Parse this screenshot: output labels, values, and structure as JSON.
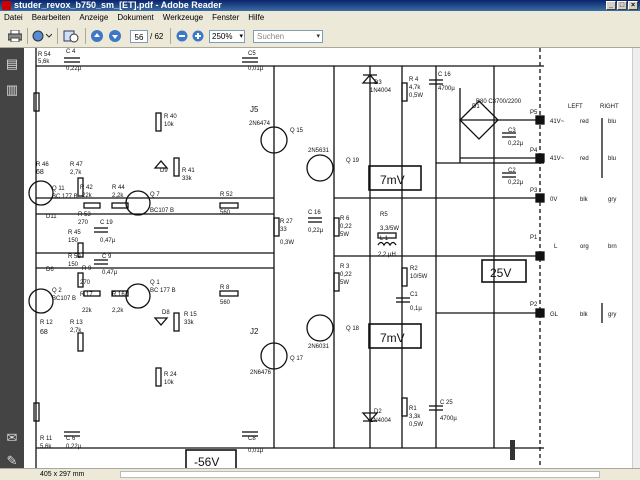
{
  "window": {
    "title": "studer_revox_b750_sm_[ET].pdf - Adobe Reader"
  },
  "menu": [
    "Datei",
    "Bearbeiten",
    "Anzeige",
    "Dokument",
    "Werkzeuge",
    "Fenster",
    "Hilfe"
  ],
  "toolbar": {
    "page_current": "56",
    "page_total": "/ 62",
    "zoom": "250%",
    "search_placeholder": "Suchen"
  },
  "status": {
    "page_size": "405 x 297 mm"
  },
  "schematic": {
    "labels": {
      "r54": "R 54",
      "r54v": "5,6k",
      "c4": "C 4",
      "c4v": "0,22µ",
      "c5": "C5",
      "c5v": "0,01µ",
      "r40": "R 40",
      "r40v": "10k",
      "j5": "J5",
      "q15": "Q 15",
      "q15t": "2N6474",
      "d9": "D9",
      "r41": "R 41",
      "r41v": "33k",
      "q19t": "2N5631",
      "q19": "Q 19",
      "r46": "R 46",
      "r46v": "68",
      "r47": "R 47",
      "r47v": "2,7k",
      "q11": "Q 11",
      "q11t": "BC 177 B",
      "r42": "R 42",
      "r42v": "22k",
      "r44": "R 44",
      "r44v": "2,2k",
      "q7": "Q 7",
      "q7t": "BC107 B",
      "r52": "R 52",
      "r52v": "560",
      "d11": "D11",
      "r53": "R 53",
      "r53v": "270",
      "c19": "C 19",
      "c19v": "0,47µ",
      "r45": "R 45",
      "r45v": "150",
      "r59": "R 59",
      "r59v": "150",
      "r9": "R 9",
      "r9v": "270",
      "c9": "C 9",
      "c9v": "0,47µ",
      "d6": "D6",
      "q2": "Q 2",
      "q2t": "BC107 B",
      "r17": "R 17",
      "r17v": "22k",
      "r16": "R 16",
      "r16v": "2,2k",
      "q1": "Q 1",
      "q1t": "BC 177 B",
      "r8": "R 8",
      "r8v": "560",
      "r12": "R 12",
      "r12v": "68",
      "r13": "R 13",
      "r13v": "2,7k",
      "d8": "D8",
      "r15": "R 15",
      "r15v": "33k",
      "j2": "J2",
      "q17": "Q 17",
      "q17t": "2N6476",
      "r24": "R 24",
      "r24v": "10k",
      "r27": "R 27",
      "r27v": "33",
      "r27w": "0,3W",
      "c16": "C 16",
      "c16v": "0,22µ",
      "r6": "R 6",
      "r6v": "0,22",
      "r6w": "5W",
      "r3": "R 3",
      "r3v": "0,22",
      "r3w": "5W",
      "q18": "Q 18",
      "q18t": "2N6031",
      "d3": "D3",
      "d3t": "1N4004",
      "r4": "R 4",
      "r4v": "4,7k",
      "r4w": "0,5W",
      "c16b": "C 16",
      "c16bv": "4700µ",
      "d1": "D1",
      "d1t": "B80 C3700/2200",
      "c3": "C3",
      "c3v": "0,22µ",
      "c2": "C2",
      "c2v": "0,22µ",
      "r5": "R5",
      "r5v": "3,3/5W",
      "l1": "L 1",
      "l1v": "2,2 µH",
      "r2": "R2",
      "r2v": "10/5W",
      "c1": "C1",
      "c1v": "0,1µ",
      "d2": "D2",
      "d2t": "1N4004",
      "r1": "R1",
      "r1v": "3,3k",
      "r1w": "0,5W",
      "c25": "C 25",
      "c25v": "4700µ",
      "r11": "R 11",
      "r11v": "5,6k",
      "c6": "C 6",
      "c6v": "0,22µ",
      "c8": "C8",
      "c8v": "0,01µ",
      "v7a": "7mV",
      "v7b": "7mV",
      "v25": "25V",
      "v56": "-56V",
      "p5": "P5",
      "p4": "P4",
      "p3": "P3",
      "p1": "P1",
      "p2": "P2",
      "left": "LEFT",
      "right": "RIGHT",
      "n41a": "41V~",
      "n41b": "41V~",
      "n0v": "0V",
      "nl": "L",
      "ngl": "GL",
      "red1": "red",
      "blu1": "blu",
      "red2": "red",
      "blu2": "blu",
      "blk1": "blk",
      "gry1": "gry",
      "org": "org",
      "brn": "brn",
      "blk2": "blk",
      "gry2": "gry"
    }
  }
}
